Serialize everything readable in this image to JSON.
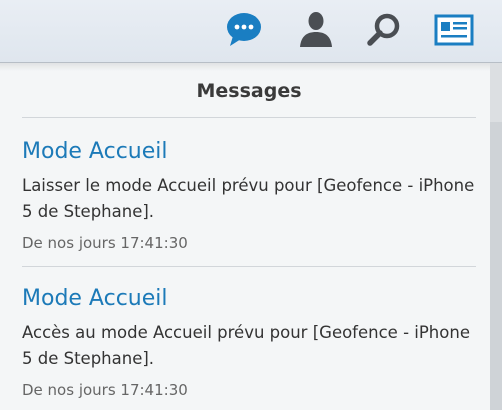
{
  "toolbar": {
    "icons": [
      "chat-bubble-icon",
      "user-icon",
      "search-icon",
      "id-card-icon"
    ]
  },
  "panel": {
    "title": "Messages"
  },
  "messages": [
    {
      "title": "Mode Accueil",
      "body": "Laisser le mode Accueil prévu pour [Geofence - iPhone 5 de Stephane].",
      "time": "De nos jours 17:41:30"
    },
    {
      "title": "Mode Accueil",
      "body": "Accès au mode Accueil prévu pour [Geofence - iPhone 5 de Stephane].",
      "time": "De nos jours 17:41:30"
    }
  ],
  "colors": {
    "accent": "#1c7ab8",
    "title_text": "#3a3a3a",
    "body_text": "#333333",
    "time_text": "#666666"
  }
}
